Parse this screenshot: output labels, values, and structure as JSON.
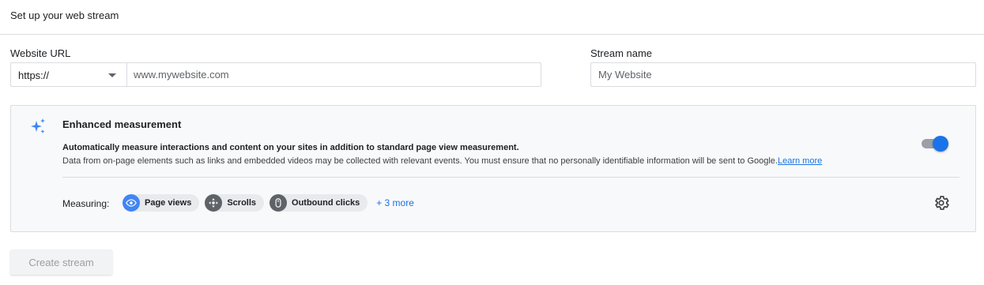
{
  "header": {
    "title": "Set up your web stream"
  },
  "url_field": {
    "label": "Website URL",
    "protocol": "https://",
    "placeholder": "www.mywebsite.com"
  },
  "stream_field": {
    "label": "Stream name",
    "placeholder": "My Website"
  },
  "enhanced_measurement": {
    "icon": "sparkle-icon",
    "title": "Enhanced measurement",
    "description": "Automatically measure interactions and content on your sites in addition to standard page view measurement.",
    "note": "Data from on-page elements such as links and embedded videos may be collected with relevant events. You must ensure that no personally identifiable information will be sent to Google.",
    "learn_more": "Learn more",
    "toggle_on": true,
    "measuring_label": "Measuring:",
    "chips": [
      {
        "label": "Page views",
        "icon": "eye-icon",
        "color": "#4285f4"
      },
      {
        "label": "Scrolls",
        "icon": "scroll-icon",
        "color": "#5f6368"
      },
      {
        "label": "Outbound clicks",
        "icon": "mouse-icon",
        "color": "#5f6368"
      }
    ],
    "more_link": "+ 3 more",
    "settings_icon": "gear-icon"
  },
  "actions": {
    "create_label": "Create stream"
  },
  "colors": {
    "accent": "#1a73e8",
    "border": "#dadce0",
    "card_bg": "#f8f9fa"
  }
}
